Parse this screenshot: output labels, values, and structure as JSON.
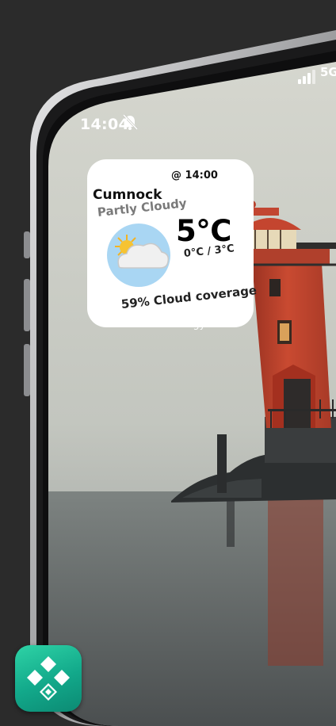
{
  "status_bar": {
    "time": "14:04",
    "network": "5G",
    "bell_icon": "bell-slash-icon",
    "signal_icon": "signal-bars-icon"
  },
  "widget": {
    "city": "Cumnock",
    "time": "@ 14:00",
    "condition": "Partly Cloudy",
    "temperature": "5°C",
    "temp_range": "0°C  /  3°C",
    "cloud_coverage": "59% Cloud coverage",
    "weather_icon": "partly-cloudy-icon",
    "app_caption": "Widgy"
  },
  "app_icon": {
    "name": "widgy-app-icon"
  },
  "colors": {
    "background": "#2b2b2b",
    "widget_bg": "#ffffff",
    "icon_circle": "#a9d6f3",
    "sun": "#f6c332",
    "app_icon_accent": "#1fb894",
    "lighthouse": "#c9472f"
  }
}
